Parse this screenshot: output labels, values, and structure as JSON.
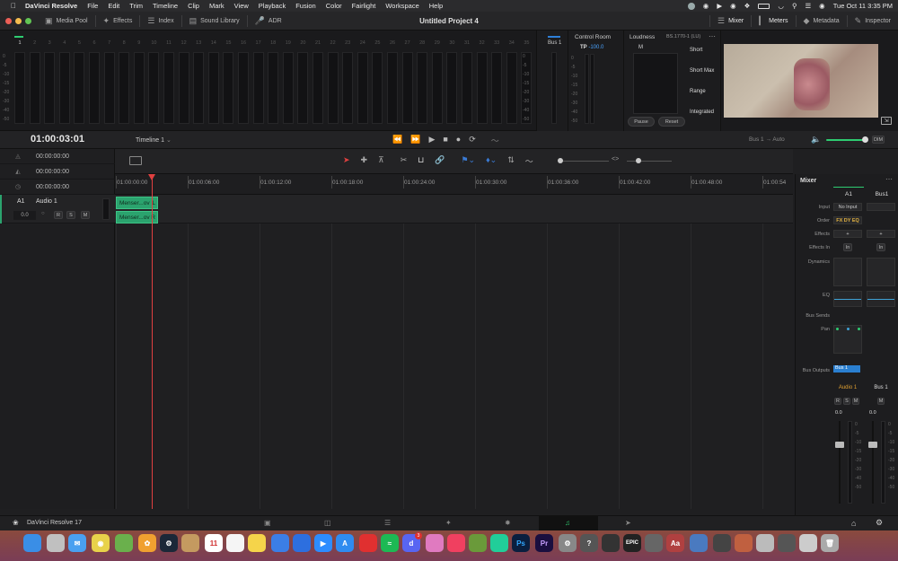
{
  "menubar": {
    "app": "DaVinci Resolve",
    "items": [
      "File",
      "Edit",
      "Trim",
      "Timeline",
      "Clip",
      "Mark",
      "View",
      "Playback",
      "Fusion",
      "Color",
      "Fairlight",
      "Workspace",
      "Help"
    ],
    "clock": "Tue Oct 11  3:35 PM"
  },
  "toolbar": {
    "media_pool": "Media Pool",
    "effects": "Effects",
    "index": "Index",
    "sound_library": "Sound Library",
    "adr": "ADR",
    "title": "Untitled Project 4",
    "mixer": "Mixer",
    "meters": "Meters",
    "metadata": "Metadata",
    "inspector": "Inspector"
  },
  "meters": {
    "channels": [
      "1",
      "2",
      "3",
      "4",
      "5",
      "6",
      "7",
      "8",
      "9",
      "10",
      "11",
      "12",
      "13",
      "14",
      "15",
      "16",
      "17",
      "18",
      "19",
      "20",
      "21",
      "22",
      "23",
      "24",
      "25",
      "26",
      "27",
      "28",
      "29",
      "30",
      "31",
      "32",
      "33",
      "34",
      "35"
    ],
    "scale": [
      "0",
      "-5",
      "-10",
      "-15",
      "-20",
      "-30",
      "-40",
      "-50"
    ]
  },
  "bus": {
    "label": "Bus 1"
  },
  "control_room": {
    "title": "Control Room",
    "tp_label": "TP",
    "tp_value": "-100.0"
  },
  "loudness": {
    "title": "Loudness",
    "standard": "BS.1770-1 (LU)",
    "m_label": "M",
    "short": "Short",
    "short_max": "Short Max",
    "range": "Range",
    "integrated": "Integrated",
    "pause": "Pause",
    "reset": "Reset"
  },
  "transport": {
    "timecode": "01:00:03:01",
    "timeline": "Timeline 1",
    "bus_out": "Bus 1",
    "auto": "Auto",
    "dim": "DIM"
  },
  "tc_rows": [
    "00:00:00:00",
    "00:00:00:00",
    "00:00:00:00"
  ],
  "ruler": [
    "01:00:00:00",
    "01:00:06:00",
    "01:00:12:00",
    "01:00:18:00",
    "01:00:24:00",
    "01:00:30:00",
    "01:00:36:00",
    "01:00:42:00",
    "01:00:48:00",
    "01:00:54"
  ],
  "track": {
    "id": "A1",
    "name": "Audio 1",
    "level": "0.0",
    "r": "R",
    "s": "S",
    "m": "M"
  },
  "clips": [
    {
      "name": "Menser...ov",
      "ch": "L"
    },
    {
      "name": "Menser...ov",
      "ch": "R"
    }
  ],
  "mixer": {
    "title": "Mixer",
    "col1": "A1",
    "col2": "Bus1",
    "input": "Input",
    "input_val": "No Input",
    "order": "Order",
    "order_val": "FX DY EQ",
    "effects": "Effects",
    "effects_in": "Effects In",
    "in": "In",
    "dynamics": "Dynamics",
    "eq": "EQ",
    "bus_sends": "Bus Sends",
    "pan": "Pan",
    "bus_outputs": "Bus Outputs",
    "bus_out_val": "Bus 1",
    "name1": "Audio 1",
    "name2": "Bus 1",
    "level1": "0.0",
    "level2": "0.0",
    "fader_scale": [
      "0",
      "-5",
      "-10",
      "-15",
      "-20",
      "-30",
      "-40",
      "-50"
    ]
  },
  "bottombar": {
    "app": "DaVinci Resolve 17"
  },
  "dock": {
    "calendar_day": "11",
    "discord_badge": "3",
    "ps": "Ps",
    "pr": "Pr",
    "epic": "EPIC"
  }
}
